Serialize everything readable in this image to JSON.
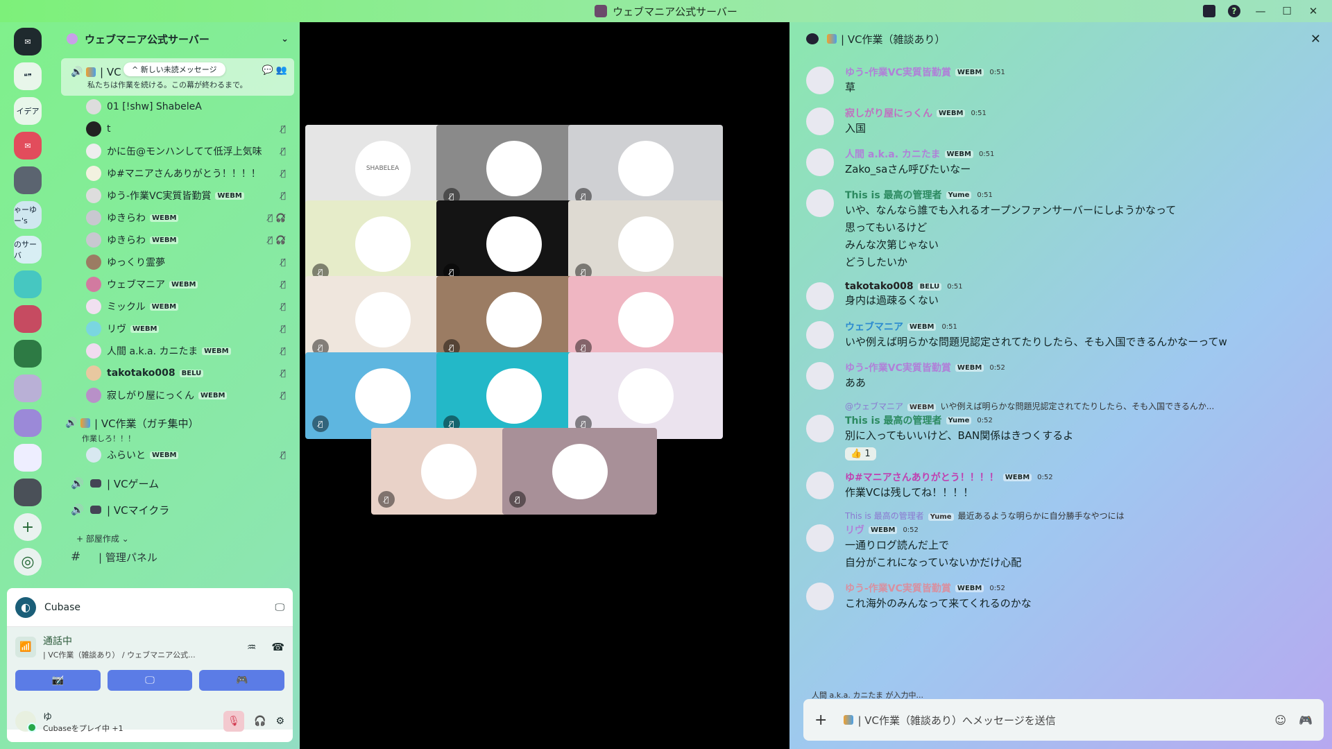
{
  "window": {
    "title": "ウェブマニア公式サーバー"
  },
  "rail": {
    "servers": [
      {
        "name": "discord-home",
        "label": "✉"
      },
      {
        "name": "quote-server",
        "label": "❝❞"
      },
      {
        "name": "idea-server",
        "label": "イデア"
      },
      {
        "name": "discord-red",
        "label": "✉"
      },
      {
        "name": "server-5",
        "label": ""
      },
      {
        "name": "server-6",
        "label": "ゃーゆー's"
      },
      {
        "name": "server-7",
        "label": "のサーバ"
      },
      {
        "name": "server-8",
        "label": ""
      },
      {
        "name": "server-9",
        "label": ""
      },
      {
        "name": "server-10",
        "label": ""
      },
      {
        "name": "server-11",
        "label": ""
      },
      {
        "name": "server-12",
        "label": ""
      },
      {
        "name": "server-13",
        "label": ""
      },
      {
        "name": "server-14",
        "label": ""
      }
    ]
  },
  "sidebar": {
    "server_name": "ウェブマニア公式サーバー",
    "active_channel": {
      "name": "| VC",
      "new_messages": "^ 新しい未読メッセージ",
      "description": "私たちは作業を続ける。この幕が終わるまで。"
    },
    "members": [
      {
        "name": "01 [!shw] ShabeleA",
        "tag": ""
      },
      {
        "name": "t",
        "tag": ""
      },
      {
        "name": "かに缶@モンハンしてて低浮上気味",
        "tag": ""
      },
      {
        "name": "ゆ#マニアさんありがとう！！！！",
        "tag": ""
      },
      {
        "name": "ゆう-作業VC実質皆勤賞",
        "tag": "WEBM"
      },
      {
        "name": "ゆきらわ",
        "tag": "WEBM"
      },
      {
        "name": "ゆきらわ",
        "tag": "WEBM"
      },
      {
        "name": "ゆっくり霊夢",
        "tag": ""
      },
      {
        "name": "ウェブマニア",
        "tag": "WEBM"
      },
      {
        "name": "ミックル",
        "tag": "WEBM"
      },
      {
        "name": "リヴ",
        "tag": "WEBM"
      },
      {
        "name": "人間 a.k.a. カニたま",
        "tag": "WEBM"
      },
      {
        "name": "takotako008",
        "tag": "BELU"
      },
      {
        "name": "寂しがり屋にっくん",
        "tag": "WEBM"
      }
    ],
    "channel2": {
      "name": "| VC作業（ガチ集中）",
      "description": "作業しろ！！！",
      "member": "ふらいと",
      "member_tag": "WEBM"
    },
    "vc_game": "| VCゲーム",
    "vc_maikura": "| VCマイクラ",
    "create_room": "+ 部屋作成 ⌄",
    "admin_panel": "| 管理パネル"
  },
  "activity": {
    "app": "Cubase"
  },
  "voice": {
    "status": "通話中",
    "location": "| VC作業（雑談あり） / ウェブマニア公式..."
  },
  "user": {
    "name": "ゆ",
    "status": "Cubaseをプレイ中 +1"
  },
  "video": {
    "tiles": [
      {
        "label": "SHABELEA",
        "bg": "#e5e5e5"
      },
      {
        "label": "",
        "bg": "#8a8a8a"
      },
      {
        "label": "",
        "bg": "#cfd0d3"
      },
      {
        "label": "",
        "bg": "#e6ecc9"
      },
      {
        "label": "",
        "bg": "#141414"
      },
      {
        "label": "",
        "bg": "#dedad2"
      },
      {
        "label": "",
        "bg": "#efe6dd"
      },
      {
        "label": "",
        "bg": "#9b7c63"
      },
      {
        "label": "",
        "bg": "#efb6c2"
      },
      {
        "label": "",
        "bg": "#5eb6e0"
      },
      {
        "label": "",
        "bg": "#23b8c8"
      },
      {
        "label": "",
        "bg": "#ebe3ee"
      },
      {
        "label": "",
        "bg": "#e9d2c8"
      },
      {
        "label": "",
        "bg": "#a89098"
      }
    ]
  },
  "chat": {
    "channel": "| VC作業（雑談あり）",
    "messages": [
      {
        "author": "ゆう-作業VC実質皆勤賞",
        "tag": "WEBM",
        "time": "0:51",
        "color": "#b080d8",
        "lines": [
          "草"
        ]
      },
      {
        "author": "寂しがり屋にっくん",
        "tag": "WEBM",
        "time": "0:51",
        "color": "#c070c0",
        "lines": [
          "入国"
        ]
      },
      {
        "author": "人間 a.k.a. カニたま",
        "tag": "WEBM",
        "time": "0:51",
        "color": "#b080d8",
        "lines": [
          "Zako_saさん呼びたいなー"
        ]
      },
      {
        "author": "This is 最高の管理者",
        "tag": "Yume",
        "time": "0:51",
        "color": "#2c8a60",
        "lines": [
          "いや、なんなら誰でも入れるオープンファンサーバーにしようかなって",
          "思ってもいるけど",
          "みんな次第じゃない",
          "どうしたいか"
        ]
      },
      {
        "author": "takotako008",
        "tag": "BELU",
        "time": "0:51",
        "color": "#222222",
        "lines": [
          "身内は過疎るくない"
        ]
      },
      {
        "author": "ウェブマニア",
        "tag": "WEBM",
        "time": "0:51",
        "color": "#2a8ad0",
        "lines": [
          "いや例えば明らかな問題児認定されてたりしたら、そも入国できるんかなーってw"
        ]
      },
      {
        "author": "ゆう-作業VC実質皆勤賞",
        "tag": "WEBM",
        "time": "0:52",
        "color": "#b080d8",
        "lines": [
          "ああ"
        ]
      }
    ],
    "reply1": {
      "name": "@ウェブマニア",
      "tag": "WEBM",
      "text": "いや例えば明らかな問題児認定されてたりしたら、そも入国できるんか..."
    },
    "msg_reply1": {
      "author": "This is 最高の管理者",
      "tag": "Yume",
      "time": "0:52",
      "color": "#2c8a60",
      "lines": [
        "別に入ってもいいけど、BAN関係はきつくするよ"
      ],
      "reaction": "👍 1"
    },
    "msg_after": {
      "author": "ゆ#マニアさんありがとう！！！！",
      "tag": "WEBM",
      "time": "0:52",
      "color": "#c040b0",
      "lines": [
        "作業VCは残してね！！！！"
      ]
    },
    "reply2": {
      "name": "This is 最高の管理者",
      "tag": "Yume",
      "text": "最近あるような明らかに自分勝手なやつには"
    },
    "msg_reply2": {
      "author": "リヴ",
      "tag": "WEBM",
      "time": "0:52",
      "color": "#b080d8",
      "lines": [
        "一通りログ読んだ上で",
        "自分がこれになっていないかだけ心配"
      ]
    },
    "msg_last": {
      "author": "ゆう-作業VC実質皆勤賞",
      "tag": "WEBM",
      "time": "0:52",
      "color": "#d890a0",
      "lines": [
        "これ海外のみんなって来てくれるのかな"
      ]
    },
    "typing": "人間 a.k.a. カニたま が入力中...",
    "compose_placeholder": "| VC作業（雑談あり）へメッセージを送信"
  }
}
